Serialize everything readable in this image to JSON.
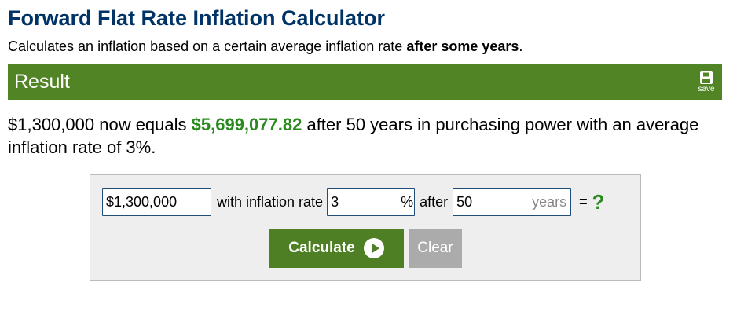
{
  "header": {
    "title": "Forward Flat Rate Inflation Calculator",
    "subtitle_prefix": "Calculates an inflation based on a certain average inflation rate ",
    "subtitle_bold": "after some years",
    "subtitle_suffix": "."
  },
  "result": {
    "heading": "Result",
    "save_label": "save",
    "text_prefix": "$1,300,000 now equals ",
    "highlight_value": "$5,699,077.82",
    "text_suffix": " after 50 years in purchasing power with an average inflation rate of 3%."
  },
  "form": {
    "amount_value": "$1,300,000",
    "label_with_rate": "with inflation rate",
    "rate_value": "3",
    "rate_unit": "%",
    "label_after": "after",
    "years_value": "50",
    "years_unit": "years",
    "equals": "=",
    "question_mark": "?",
    "calculate_label": "Calculate",
    "clear_label": "Clear"
  },
  "colors": {
    "title": "#003366",
    "result_bar": "#518425",
    "highlight": "#2a8a1e",
    "calculate_button": "#4e7f25",
    "clear_button": "#ababab",
    "panel_background": "#eeeeee"
  },
  "icons": {
    "save": "floppy-disk-icon",
    "calculate": "play-circle-icon"
  }
}
